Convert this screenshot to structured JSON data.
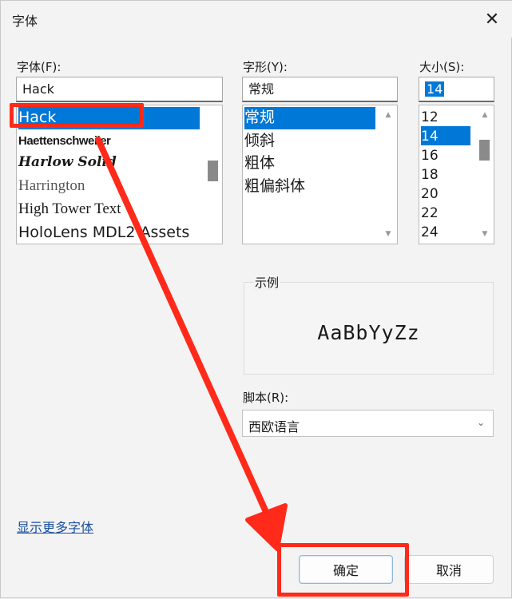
{
  "window": {
    "title": "字体",
    "close_icon": "close-icon"
  },
  "font": {
    "label": "字体(F):",
    "value": "Hack",
    "items": [
      "Hack",
      "Haettenschweiler",
      "Harlow Solid",
      "Harrington",
      "High Tower Text",
      "HoloLens MDL2 Assets"
    ],
    "selected_index": 0
  },
  "style": {
    "label": "字形(Y):",
    "value": "常规",
    "items": [
      "常规",
      "倾斜",
      "粗体",
      "粗偏斜体"
    ],
    "selected_index": 0
  },
  "size": {
    "label": "大小(S):",
    "value": "14",
    "items": [
      "12",
      "14",
      "16",
      "18",
      "20",
      "22",
      "24"
    ],
    "selected_index": 1
  },
  "sample": {
    "label": "示例",
    "text": "AaBbYyZz"
  },
  "script": {
    "label": "脚本(R):",
    "value": "西欧语言"
  },
  "more_fonts_link": "显示更多字体",
  "buttons": {
    "ok": "确定",
    "cancel": "取消"
  },
  "colors": {
    "selection": "#0078d7",
    "annotation": "#ff2a1a",
    "link": "#1a4fa0"
  }
}
